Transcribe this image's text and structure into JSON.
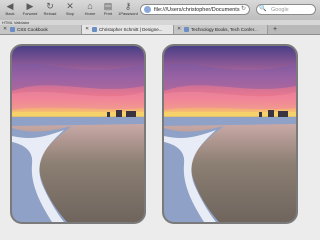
{
  "toolbar": {
    "buttons": [
      {
        "label": "Back",
        "icon": "back-arrow-icon",
        "glyph": "◀"
      },
      {
        "label": "Forward",
        "icon": "forward-arrow-icon",
        "glyph": "▶"
      },
      {
        "label": "Reload",
        "icon": "reload-icon",
        "glyph": "↻"
      },
      {
        "label": "Stop",
        "icon": "stop-icon",
        "glyph": "✕"
      },
      {
        "label": "Home",
        "icon": "home-icon",
        "glyph": "⌂"
      },
      {
        "label": "Print",
        "icon": "print-icon",
        "glyph": "▤"
      },
      {
        "label": "1Password",
        "icon": "key-icon",
        "glyph": "⚷"
      }
    ],
    "url": "file:///Users/christopher/Documents",
    "search_placeholder": "Google"
  },
  "bookmarks_bar": {
    "item": "HTML Validator"
  },
  "tabs": [
    {
      "title": "CSS Cookbook",
      "active": false
    },
    {
      "title": "Christopher Schmitt | Designe...",
      "active": true
    },
    {
      "title": "Technology Books, Tech Confer...",
      "active": false
    }
  ],
  "new_tab_label": "+",
  "colors": {
    "sky_top": "#4a3f86",
    "sky_mid": "#b86ba0",
    "sunset_pink": "#f17a8c",
    "sunset_yellow": "#f6d36a",
    "ocean": "#8fa1c6",
    "foam": "#f2f4fb",
    "sand": "#8c7f73",
    "frame_border": "#7a7a7a"
  }
}
